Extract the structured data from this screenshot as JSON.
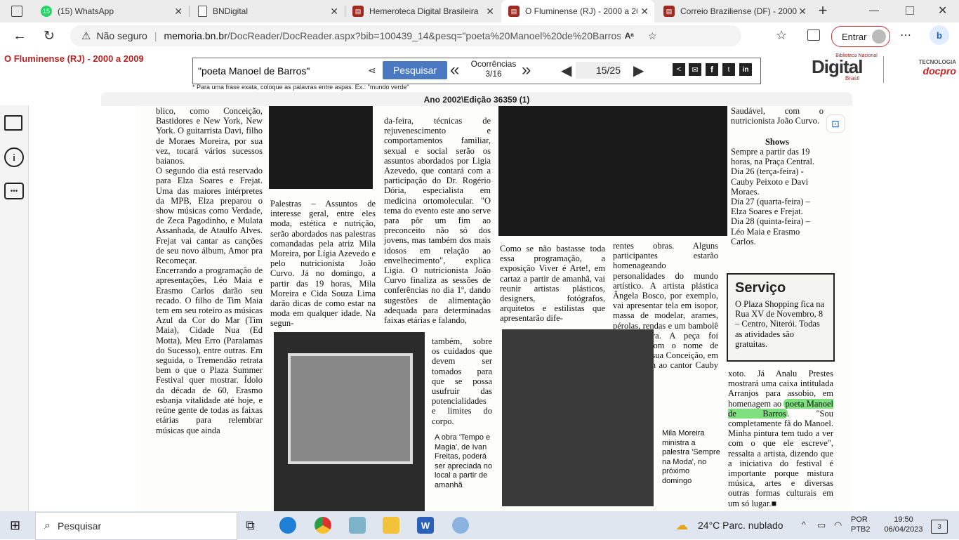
{
  "tabs": [
    {
      "title": "(15) WhatsApp",
      "badge": "15",
      "icon": "whatsapp-icon"
    },
    {
      "title": "BNDigital",
      "icon": "page-icon"
    },
    {
      "title": "Hemeroteca Digital Brasileira",
      "icon": "docreader-icon"
    },
    {
      "title": "O Fluminense (RJ) - 2000 a 2009",
      "icon": "docreader-icon",
      "active": true
    },
    {
      "title": "Correio Braziliense (DF) - 2000",
      "icon": "docreader-icon"
    }
  ],
  "address": {
    "security": "Não seguro",
    "url_host": "memoria.bn.br",
    "url_rest": "/DocReader/DocReader.aspx?bib=100439_14&pesq=\"poeta%20Manoel%20de%20Barros\"&pasta=ano%202...",
    "signin": "Entrar"
  },
  "header": {
    "paper_title": "O Fluminense (RJ) - 2000 a 2009",
    "search_value": "\"poeta Manoel de Barros\"",
    "search_button": "Pesquisar",
    "occurrences_label": "Ocorrências",
    "occurrences_value": "3/16",
    "page_current": "15",
    "page_total": "/25",
    "hint": "* Para uma frase exata, coloque as palavras entre aspas. Ex.: \"mundo verde\"",
    "edition": "Ano 2002\\Edição 36359 (1)",
    "logo_small": "Biblioteca Nacional",
    "logo_main": "Digital",
    "logo_sub": "Brasil",
    "tech_label": "TECNOLOGIA",
    "tech_brand": "docpro"
  },
  "newspaper": {
    "col1": "blico, como Conceição, Bastidores e New York, New York. O guitarrista Davi, filho de Moraes Moreira, por sua vez, tocará vários sucessos baianos.\n   O segundo dia está reservado para Elza Soares e Frejat. Uma das maiores intérpretes da MPB, Elza preparou o show músicas como Verdade, de Zeca Pagodinho, e Mulata Assanhada, de Ataulfo Alves. Frejat vai cantar as canções de seu novo álbum, Amor pra Recomeçar.\n   Encerrando a programação de apresentações, Léo Maia e Erasmo Carlos darão seu recado. O filho de Tim Maia tem em seu roteiro as músicas Azul da Cor do Mar (Tim Maia), Cidade Nua (Ed Motta), Meu Erro (Paralamas do Sucesso), entre outras. Em seguida, o Tremendão retrata bem o que o Plaza Summer Festival quer mostrar. Ídolo da década de 60, Erasmo esbanja vitalidade até hoje, e reúne gente de todas as faixas etárias para relembrar músicas que ainda",
    "col2": "Palestras – Assuntos de interesse geral, entre eles moda, estética e nutrição, serão abordados nas palestras comandadas pela atriz Mila Moreira, por Lígia Azevedo e pelo nutricionista João Curvo. Já no domingo, a partir das 19 horas, Mila Moreira e Cida Souza Lima darão dicas de como estar na moda em qualquer idade. Na segun-",
    "col3a": "da-feira, técnicas de rejuvenescimento e comportamentos familiar, sexual e social serão os assuntos abordados por Ligia Azevedo, que contará com a participação do Dr. Rogério Dória, especialista em medicina ortomolecular. \"O tema do evento este ano serve para pôr um fim ao preconceito não só dos jovens, mas também dos mais idosos em relação ao envelhecimento\", explica Ligia. O nutricionista João Curvo finaliza as sessões de conferências no dia 1º, dando sugestões de alimentação adequada para determinadas faixas etárias e falando,",
    "col3b": "também, sobre os cuidados que devem ser tomados para que se possa usufruir das potencialidades e limites do corpo.",
    "caption1": "A obra 'Tempo e Magia', de Ivan Freitas, poderá ser apreciada no local a partir de amanhã",
    "col4": "Como se não bastasse toda essa programação, a exposição Viver é Arte!, em cartaz a partir de amanhã, vai reunir artistas plásticos, designers, fotógrafos, arquitetos e estilistas que apresentarão dife-",
    "col5": "rentes obras. Alguns participantes estarão homenageando personalidades do mundo artístico. A artista plástica Ângela Bosco, por exemplo, vai apresentar tela em isopor, massa de modelar, arames, pérolas, rendas e um bambolê de moldura. A peça foi batizada com o nome de Queria ser sua Conceição, em homenagem ao cantor Cauby Pei-",
    "caption2": "Mila Moreira ministra a palestra 'Sempre na Moda', no próximo domingo",
    "col6": "Saudável, com o nutricionista João Curvo.",
    "shows_title": "Shows",
    "shows_text": "Sempre a partir das 19 horas, na Praça Central.\nDia 26 (terça-feira) - Cauby Peixoto e Davi Moraes.\nDia 27 (quarta-feira) – Elza Soares e Frejat.\nDia 28 (quinta-feira) – Léo Maia e Erasmo Carlos.",
    "servico_title": "Serviço",
    "servico_text": "O Plaza Shopping fica na Rua XV de Novembro, 8 – Centro, Niterói. Todas as atividades são gratuitas.",
    "col7_pre": "xoto. Já Analu Prestes mostrará uma caixa intitulada Arranjos para assobio, em homenagem ao",
    "col7_hl": "poeta Manoel de Barros",
    "col7_post": ". \"Sou completamente fã do Manoel. Minha pintura tem tudo a ver com o que ele escreve\", ressalta a artista, dizendo que a iniciativa do festival é importante porque mistura música, artes e diversas outras formas culturais em um só lugar.■"
  },
  "taskbar": {
    "search": "Pesquisar",
    "weather": "24°C  Parc. nublado",
    "lang1": "POR",
    "lang2": "PTB2",
    "time": "19:50",
    "date": "06/04/2023",
    "notif": "3"
  }
}
